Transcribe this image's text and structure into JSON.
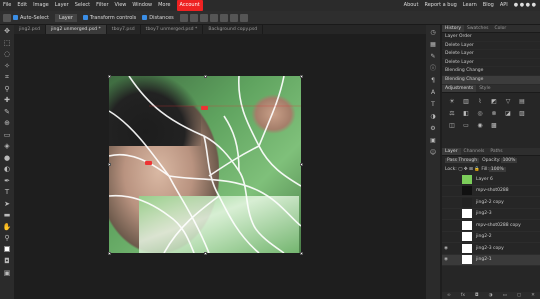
{
  "menu": {
    "items": [
      "File",
      "Edit",
      "Image",
      "Layer",
      "Select",
      "Filter",
      "View",
      "Window",
      "More"
    ],
    "account": "Account",
    "right": [
      "About",
      "Report a bug",
      "Learn",
      "Blog",
      "API"
    ]
  },
  "options": {
    "auto_select": "Auto-Select",
    "layer_select": "Layer",
    "transform_controls": "Transform controls",
    "distances": "Distances"
  },
  "tabs": [
    {
      "label": "jing2.psd",
      "active": false
    },
    {
      "label": "jing2 unmerged.psd *",
      "active": true
    },
    {
      "label": "tboy7.psd",
      "active": false
    },
    {
      "label": "tboy7 unmerged.psd *",
      "active": false
    },
    {
      "label": "Background copy.psd",
      "active": false
    }
  ],
  "history_panel": {
    "tabs": [
      "History",
      "Swatches",
      "Color"
    ],
    "items": [
      "Layer Order",
      "Delete Layer",
      "Delete Layer",
      "Delete Layer",
      "Blending Change",
      "Blending Change"
    ]
  },
  "adjust_panel": {
    "tabs": [
      "Adjustments",
      "Style"
    ]
  },
  "layers_panel": {
    "tabs": [
      "Layer",
      "Channels",
      "Paths"
    ],
    "blend_mode": "Pass Through",
    "opacity_label": "Opacity:",
    "opacity_value": "100%",
    "lock_label": "Lock:",
    "fill_label": "Fill:",
    "fill_value": "100%",
    "layers": [
      {
        "name": "Layer 6",
        "thumb": "#7ccd5a"
      },
      {
        "name": "mpv-shot0288",
        "thumb": "#111111"
      },
      {
        "name": "jing2-2 copy",
        "thumb": "#222222"
      },
      {
        "name": "jing2-3",
        "thumb": "#ffffff"
      },
      {
        "name": "mpv-shot0288 copy",
        "thumb": "#ffffff"
      },
      {
        "name": "jing2-2",
        "thumb": "#ffffff"
      },
      {
        "name": "jing2-3 copy",
        "thumb": "#ffffff"
      },
      {
        "name": "jing2-1",
        "thumb": "#ffffff"
      }
    ]
  },
  "colors": {
    "accent": "#3a8ee6",
    "account": "#e22222"
  }
}
